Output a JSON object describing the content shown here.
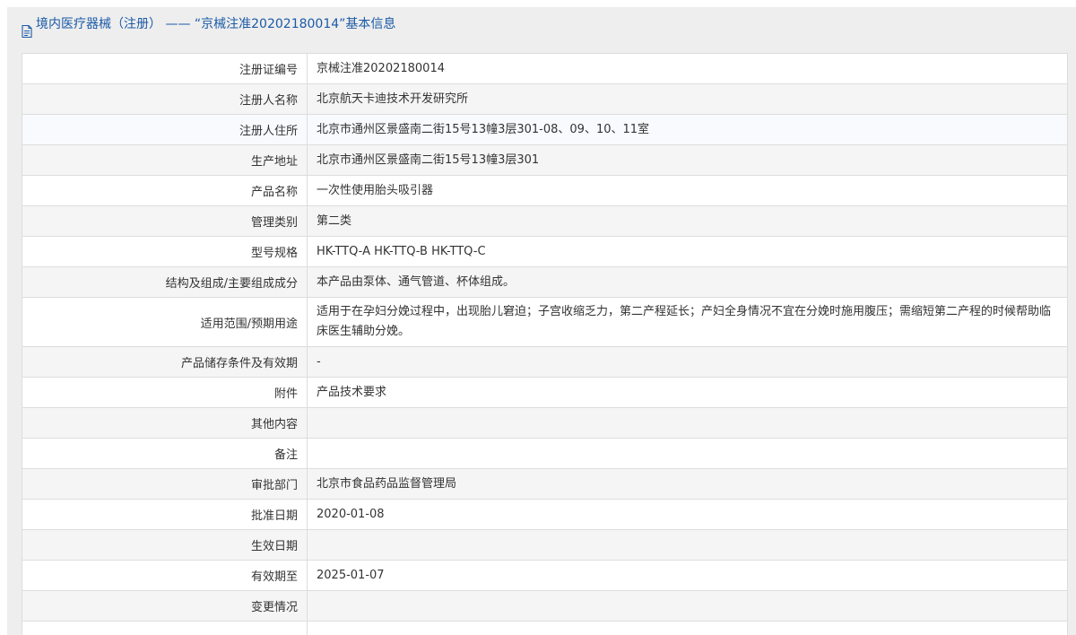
{
  "header": {
    "title": "境内医疗器械（注册） —— “京械注准20202180014”基本信息"
  },
  "rows": [
    {
      "label": "注册证编号",
      "value": "京械注准20202180014"
    },
    {
      "label": "注册人名称",
      "value": "北京航天卡迪技术开发研究所"
    },
    {
      "label": "注册人住所",
      "value": "北京市通州区景盛南二街15号13幢3层301-08、09、10、11室"
    },
    {
      "label": "生产地址",
      "value": "北京市通州区景盛南二街15号13幢3层301"
    },
    {
      "label": "产品名称",
      "value": "一次性使用胎头吸引器"
    },
    {
      "label": "管理类别",
      "value": "第二类"
    },
    {
      "label": "型号规格",
      "value": "HK-TTQ-A HK-TTQ-B HK-TTQ-C"
    },
    {
      "label": "结构及组成/主要组成成分",
      "value": "本产品由泵体、通气管道、杯体组成。"
    },
    {
      "label": "适用范围/预期用途",
      "value": "适用于在孕妇分娩过程中，出现胎儿窘迫；子宫收缩乏力，第二产程延长；产妇全身情况不宜在分娩时施用腹压；需缩短第二产程的时候帮助临床医生辅助分娩。"
    },
    {
      "label": "产品储存条件及有效期",
      "value": "-"
    },
    {
      "label": "附件",
      "value": "产品技术要求"
    },
    {
      "label": "其他内容",
      "value": ""
    },
    {
      "label": "备注",
      "value": ""
    },
    {
      "label": "审批部门",
      "value": "北京市食品药品监督管理局"
    },
    {
      "label": "批准日期",
      "value": "2020-01-08"
    },
    {
      "label": "生效日期",
      "value": ""
    },
    {
      "label": "有效期至",
      "value": "2025-01-07"
    },
    {
      "label": "变更情况",
      "value": ""
    }
  ]
}
